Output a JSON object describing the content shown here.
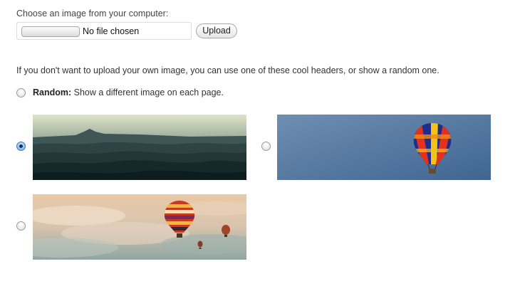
{
  "upload": {
    "label": "Choose an image from your computer:",
    "file_status": "No file chosen",
    "button_label": "Upload"
  },
  "headers": {
    "description": "If you don't want to upload your own image, you can use one of these cool headers, or show a random one.",
    "random_label": "Random:",
    "random_text": " Show a different image on each page.",
    "options": [
      {
        "image": "misty-mountains",
        "selected": true
      },
      {
        "image": "hot-air-balloon-blue-sky",
        "selected": false
      },
      {
        "image": "hot-air-balloons-cloudy-sky",
        "selected": false
      }
    ]
  }
}
